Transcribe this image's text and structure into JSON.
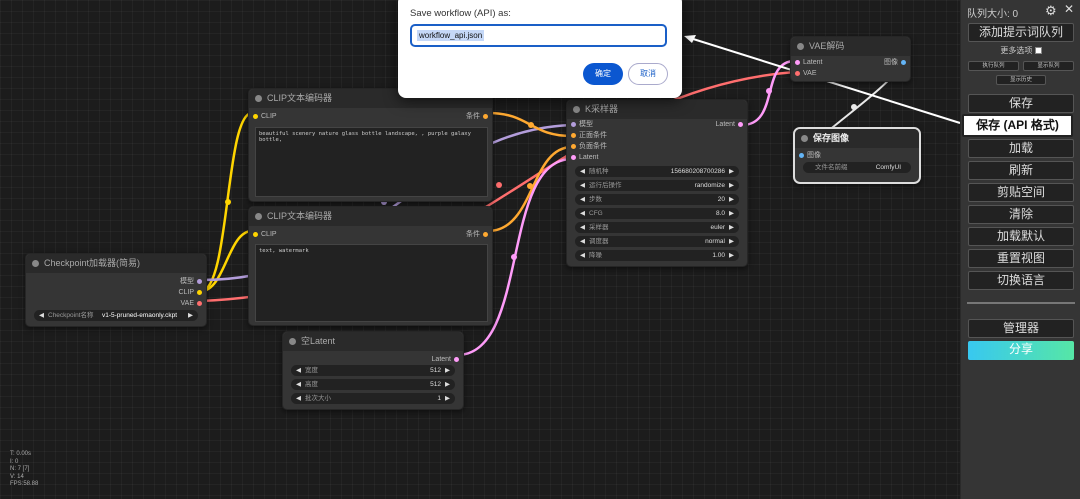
{
  "dialog": {
    "message": "Save workflow (API) as:",
    "input_value": "workflow_api.json",
    "ok_label": "确定",
    "cancel_label": "取消"
  },
  "menu": {
    "queue_size": "队列大小: 0",
    "gear_icon": "gear-icon",
    "close_icon": "close-icon",
    "queue_prompt": "添加提示词队列",
    "extra_options": "更多选项",
    "extra_checked": false,
    "view_queue": "执行队列",
    "view_history_btn": "显示队列",
    "history": "显示历史",
    "save": "保存",
    "save_api": "保存 (API 格式)",
    "load": "加载",
    "refresh": "刷新",
    "clipspace": "剪贴空间",
    "clear": "清除",
    "load_default": "加载默认",
    "reset_view": "重置视图",
    "switch_lang": "切换语言",
    "manager": "管理器",
    "share": "分享"
  },
  "nodes": {
    "checkpoint": {
      "title": "Checkpoint加载器(简易)",
      "outputs": [
        "模型",
        "CLIP",
        "VAE"
      ],
      "widget_name": "Checkpoint名称",
      "widget_value": "v1-5-pruned-emaonly.ckpt"
    },
    "clip_pos": {
      "title": "CLIP文本编码器",
      "input": "CLIP",
      "output": "条件",
      "text": "beautiful scenery nature glass bottle landscape, , purple galaxy bottle,"
    },
    "clip_neg": {
      "title": "CLIP文本编码器",
      "input": "CLIP",
      "output": "条件",
      "text": "text, watermark"
    },
    "empty_latent": {
      "title": "空Latent",
      "output": "Latent",
      "widgets": [
        {
          "name": "宽度",
          "value": "512"
        },
        {
          "name": "高度",
          "value": "512"
        },
        {
          "name": "批次大小",
          "value": "1"
        }
      ]
    },
    "ksampler": {
      "title": "K采样器",
      "inputs": [
        "模型",
        "正面条件",
        "负面条件",
        "Latent"
      ],
      "output": "Latent",
      "widgets": [
        {
          "name": "随机种",
          "value": "156680208700286"
        },
        {
          "name": "运行后操作",
          "value": "randomize"
        },
        {
          "name": "步数",
          "value": "20"
        },
        {
          "name": "CFG",
          "value": "8.0"
        },
        {
          "name": "采样器",
          "value": "euler"
        },
        {
          "name": "调度器",
          "value": "normal"
        },
        {
          "name": "降噪",
          "value": "1.00"
        }
      ]
    },
    "vae_decode": {
      "title": "VAE解码",
      "inputs": [
        "Latent",
        "VAE"
      ],
      "output": "图像"
    },
    "save_image": {
      "title": "保存图像",
      "input": "图像",
      "widget_name": "文件名前缀",
      "widget_value": "ComfyUI"
    }
  },
  "stats": {
    "t": "T: 0.00s",
    "i": "I: 0",
    "n": "N: 7 [7]",
    "v": "V: 14",
    "fps": "FPS:58.88"
  },
  "colors": {
    "model": "#b39ddb",
    "clip": "#ffd500",
    "conditioning": "#ffa931",
    "latent": "#ff9cf9",
    "vae": "#ff6e6e",
    "image": "#64b5f6",
    "dialog_accent": "#0b57d0"
  }
}
